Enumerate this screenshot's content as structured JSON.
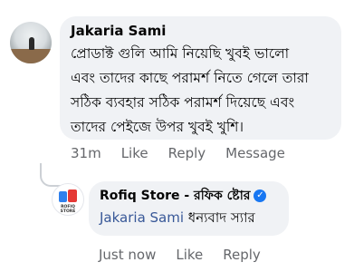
{
  "comment": {
    "author": "Jakaria Sami",
    "lines": [
      "প্রোডাক্ট গুলি আমি নিয়েছি খুবই ভালো",
      "এবং তাদের কাছে পরামর্শ নিতে গেলে তারা",
      "সঠিক ব্যবহার সঠিক পরামর্শ দিয়েছে এবং",
      "তাদের পেইজে উপর খুবই খুশি।"
    ],
    "time": "31m",
    "like_label": "Like",
    "reply_label": "Reply",
    "message_label": "Message"
  },
  "reply": {
    "author": "Rofiq Store - রফিক ষ্টোর",
    "logo_text": "ROFIQ STORE",
    "mention": "Jakaria Sami",
    "text": " ধন্যবাদ স্যার",
    "time": "Just now",
    "like_label": "Like",
    "reply_label": "Reply"
  },
  "colors": {
    "bubble": "#f0f2f5",
    "meta_text": "#65676b",
    "mention": "#385898",
    "verified": "#1877f2"
  }
}
